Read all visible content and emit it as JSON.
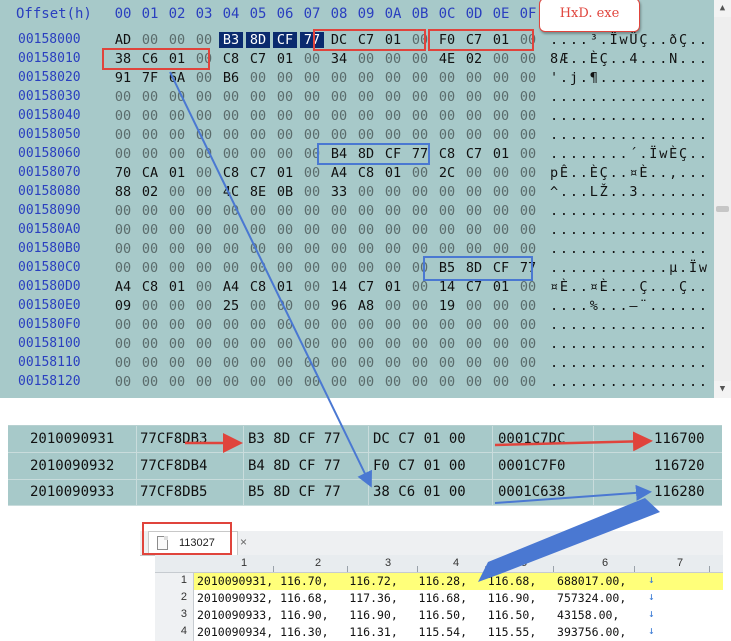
{
  "app_badge": "HxD. exe",
  "hex_editor": {
    "header_offset": "Offset(h)",
    "columns": [
      "00",
      "01",
      "02",
      "03",
      "04",
      "05",
      "06",
      "07",
      "08",
      "09",
      "0A",
      "0B",
      "0C",
      "0D",
      "0E",
      "0F"
    ],
    "rows": [
      {
        "addr": "00158000",
        "bytes": [
          "AD",
          "00",
          "00",
          "00",
          "B3",
          "8D",
          "CF",
          "77",
          "DC",
          "C7",
          "01",
          "00",
          "F0",
          "C7",
          "01",
          "00"
        ],
        "ascii": "....³.ÏwÜÇ..ðÇ.."
      },
      {
        "addr": "00158010",
        "bytes": [
          "38",
          "C6",
          "01",
          "00",
          "C8",
          "C7",
          "01",
          "00",
          "34",
          "00",
          "00",
          "00",
          "4E",
          "02",
          "00",
          "00"
        ],
        "ascii": "8Æ..ÈÇ..4...N..."
      },
      {
        "addr": "00158020",
        "bytes": [
          "91",
          "7F",
          "6A",
          "00",
          "B6",
          "00",
          "00",
          "00",
          "00",
          "00",
          "00",
          "00",
          "00",
          "00",
          "00",
          "00"
        ],
        "ascii": "'.j.¶..........."
      },
      {
        "addr": "00158030",
        "bytes": [
          "00",
          "00",
          "00",
          "00",
          "00",
          "00",
          "00",
          "00",
          "00",
          "00",
          "00",
          "00",
          "00",
          "00",
          "00",
          "00"
        ],
        "ascii": "................"
      },
      {
        "addr": "00158040",
        "bytes": [
          "00",
          "00",
          "00",
          "00",
          "00",
          "00",
          "00",
          "00",
          "00",
          "00",
          "00",
          "00",
          "00",
          "00",
          "00",
          "00"
        ],
        "ascii": "................"
      },
      {
        "addr": "00158050",
        "bytes": [
          "00",
          "00",
          "00",
          "00",
          "00",
          "00",
          "00",
          "00",
          "00",
          "00",
          "00",
          "00",
          "00",
          "00",
          "00",
          "00"
        ],
        "ascii": "................"
      },
      {
        "addr": "00158060",
        "bytes": [
          "00",
          "00",
          "00",
          "00",
          "00",
          "00",
          "00",
          "00",
          "B4",
          "8D",
          "CF",
          "77",
          "C8",
          "C7",
          "01",
          "00"
        ],
        "ascii": "........´.ÏwÈÇ.."
      },
      {
        "addr": "00158070",
        "bytes": [
          "70",
          "CA",
          "01",
          "00",
          "C8",
          "C7",
          "01",
          "00",
          "A4",
          "C8",
          "01",
          "00",
          "2C",
          "00",
          "00",
          "00"
        ],
        "ascii": "pÊ..ÈÇ..¤È..,..."
      },
      {
        "addr": "00158080",
        "bytes": [
          "88",
          "02",
          "00",
          "00",
          "4C",
          "8E",
          "0B",
          "00",
          "33",
          "00",
          "00",
          "00",
          "00",
          "00",
          "00",
          "00"
        ],
        "ascii": "^...LŽ..3......."
      },
      {
        "addr": "00158090",
        "bytes": [
          "00",
          "00",
          "00",
          "00",
          "00",
          "00",
          "00",
          "00",
          "00",
          "00",
          "00",
          "00",
          "00",
          "00",
          "00",
          "00"
        ],
        "ascii": "................"
      },
      {
        "addr": "001580A0",
        "bytes": [
          "00",
          "00",
          "00",
          "00",
          "00",
          "00",
          "00",
          "00",
          "00",
          "00",
          "00",
          "00",
          "00",
          "00",
          "00",
          "00"
        ],
        "ascii": "................"
      },
      {
        "addr": "001580B0",
        "bytes": [
          "00",
          "00",
          "00",
          "00",
          "00",
          "00",
          "00",
          "00",
          "00",
          "00",
          "00",
          "00",
          "00",
          "00",
          "00",
          "00"
        ],
        "ascii": "................"
      },
      {
        "addr": "001580C0",
        "bytes": [
          "00",
          "00",
          "00",
          "00",
          "00",
          "00",
          "00",
          "00",
          "00",
          "00",
          "00",
          "00",
          "B5",
          "8D",
          "CF",
          "77"
        ],
        "ascii": "............µ.Ïw"
      },
      {
        "addr": "001580D0",
        "bytes": [
          "A4",
          "C8",
          "01",
          "00",
          "A4",
          "C8",
          "01",
          "00",
          "14",
          "C7",
          "01",
          "00",
          "14",
          "C7",
          "01",
          "00"
        ],
        "ascii": "¤È..¤È...Ç...Ç.."
      },
      {
        "addr": "001580E0",
        "bytes": [
          "09",
          "00",
          "00",
          "00",
          "25",
          "00",
          "00",
          "00",
          "96",
          "A8",
          "00",
          "00",
          "19",
          "00",
          "00",
          "00"
        ],
        "ascii": "....%...–¨......"
      },
      {
        "addr": "001580F0",
        "bytes": [
          "00",
          "00",
          "00",
          "00",
          "00",
          "00",
          "00",
          "00",
          "00",
          "00",
          "00",
          "00",
          "00",
          "00",
          "00",
          "00"
        ],
        "ascii": "................"
      },
      {
        "addr": "00158100",
        "bytes": [
          "00",
          "00",
          "00",
          "00",
          "00",
          "00",
          "00",
          "00",
          "00",
          "00",
          "00",
          "00",
          "00",
          "00",
          "00",
          "00"
        ],
        "ascii": "................"
      },
      {
        "addr": "00158110",
        "bytes": [
          "00",
          "00",
          "00",
          "00",
          "00",
          "00",
          "00",
          "00",
          "00",
          "00",
          "00",
          "00",
          "00",
          "00",
          "00",
          "00"
        ],
        "ascii": "................"
      },
      {
        "addr": "00158120",
        "bytes": [
          "00",
          "00",
          "00",
          "00",
          "00",
          "00",
          "00",
          "00",
          "00",
          "00",
          "00",
          "00",
          "00",
          "00",
          "00",
          "00"
        ],
        "ascii": "................"
      }
    ]
  },
  "mid_table": {
    "rows": [
      {
        "date": "2010090931",
        "hex": "77CF8DB3",
        "bytes_a": "B3 8D CF 77",
        "bytes_b": "DC C7 01 00",
        "offset": "0001C7DC",
        "value": "116700"
      },
      {
        "date": "2010090932",
        "hex": "77CF8DB4",
        "bytes_a": "B4 8D CF 77",
        "bytes_b": "F0 C7 01 00",
        "offset": "0001C7F0",
        "value": "116720"
      },
      {
        "date": "2010090933",
        "hex": "77CF8DB5",
        "bytes_a": "B5 8D CF 77",
        "bytes_b": "38 C6 01 00",
        "offset": "0001C638",
        "value": "116280"
      }
    ]
  },
  "text_editor": {
    "tab_label": "113027",
    "tab_close": "×",
    "ruler": [
      "1",
      "2",
      "3",
      "4",
      "5",
      "6",
      "7"
    ],
    "lines": [
      {
        "num": "1",
        "text": "2010090931, 116.70,   116.72,   116.28,   116.68,   688017.00,"
      },
      {
        "num": "2",
        "text": "2010090932, 116.68,   117.36,   116.68,   116.90,   757324.00,"
      },
      {
        "num": "3",
        "text": "2010090933, 116.90,   116.90,   116.50,   116.50,   43158.00,"
      },
      {
        "num": "4",
        "text": "2010090934, 116.30,   116.31,   115.54,   115.55,   393756.00,"
      }
    ],
    "eol_glyph": "↓"
  },
  "colors": {
    "panel": "#a7c9c9",
    "highlight_red": "#e0443c",
    "highlight_blue": "#4a78d2",
    "arrow_blue": "#4a78d2",
    "selection": "#0a2a6e",
    "line_highlight": "#ffff7a"
  }
}
